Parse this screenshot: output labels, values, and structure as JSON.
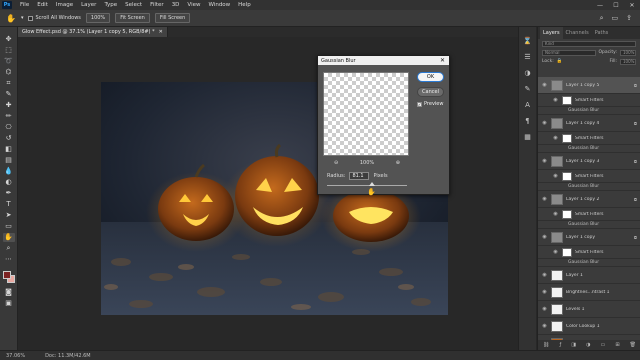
{
  "app": {
    "logo": "Ps"
  },
  "menu": [
    "File",
    "Edit",
    "Image",
    "Layer",
    "Type",
    "Select",
    "Filter",
    "3D",
    "View",
    "Window",
    "Help"
  ],
  "window_controls": [
    "—",
    "☐",
    "✕"
  ],
  "options_bar": {
    "scroll_all_label": "Scroll All Windows",
    "zoom_100": "100%",
    "fit_screen": "Fit Screen",
    "fill_screen": "Fill Screen"
  },
  "document": {
    "tab_title": "Glow Effect.psd @ 37.1% (Layer 1 copy 5, RGB/8#) *",
    "close": "✕"
  },
  "colors": {
    "foreground": "#7c2323",
    "background": "#e8a8a0",
    "accent": "#31a8ff"
  },
  "status": {
    "zoom": "37.06%",
    "doc": "Doc: 11.3M/42.6M"
  },
  "layers_panel": {
    "tabs": [
      "Layers",
      "Channels",
      "Paths"
    ],
    "kind_placeholder": "Kind",
    "blend_mode": "Normal",
    "opacity_label": "Opacity:",
    "opacity_value": "100%",
    "lock_label": "Lock:",
    "fill_label": "Fill:",
    "fill_value": "100%",
    "layers": [
      {
        "name": "Layer 1 copy 5",
        "selected": true
      },
      {
        "name": "Layer 1 copy 4",
        "selected": false
      },
      {
        "name": "Layer 1 copy 3",
        "selected": false
      },
      {
        "name": "Layer 1 copy 2",
        "selected": false
      },
      {
        "name": "Layer 1 copy",
        "selected": false
      }
    ],
    "smart_filters_label": "Smart Filters",
    "filter_name": "Gaussian Blur",
    "base_layers": [
      {
        "name": "Layer 1"
      },
      {
        "name": "Brightnes...ntrast 1"
      },
      {
        "name": "Levels 1"
      },
      {
        "name": "Color Lookup 1"
      },
      {
        "name": "Layer 0 copy"
      }
    ]
  },
  "dialog": {
    "title": "Gaussian Blur",
    "ok": "OK",
    "cancel": "Cancel",
    "preview_label": "Preview",
    "preview_checked": true,
    "zoom_out": "⊖",
    "zoom_level": "100%",
    "zoom_in": "⊕",
    "radius_label": "Radius:",
    "radius_value": "81.1",
    "radius_unit": "Pixels",
    "radius_slider_fraction": 0.56
  }
}
